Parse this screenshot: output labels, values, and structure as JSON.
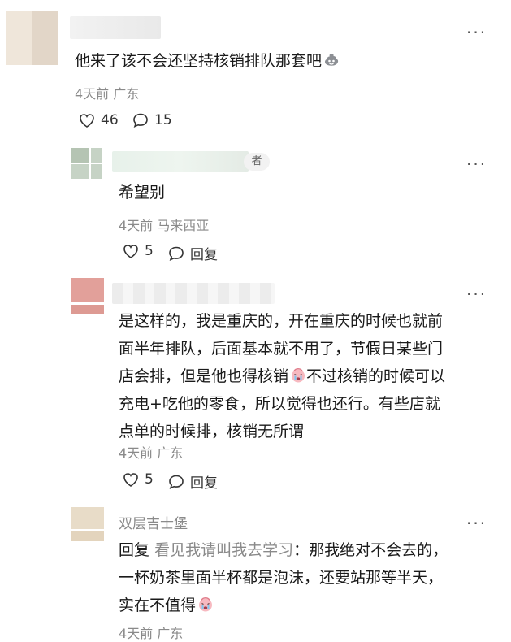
{
  "comments": [
    {
      "body_a": "他来了该不会还坚持核销排队那套吧",
      "emoji": "poop-emoji",
      "time_location": "4天前 广东",
      "likes": "46",
      "replies": "15"
    },
    {
      "author_badge": "者",
      "body": "希望别",
      "time_location": "4天前 马来西亚",
      "likes": "5",
      "reply_label": "回复"
    },
    {
      "body_line1": "是这样的，我是重庆的，开在重庆的时候也就前",
      "body_line2": "面半年排队，后面基本就不用了，节假日某些门",
      "body_line3a": "店会排，但是他也得核销",
      "body_line3b": "不过核销的时候可以",
      "body_line4": "充电+吃他的零食，所以觉得也还行。有些店就",
      "body_line5": "点单的时候排，核销无所谓",
      "emoji": "crying-face-emoji",
      "time_location": "4天前 广东",
      "likes": "5",
      "reply_label": "回复"
    },
    {
      "author": "双层吉士堡",
      "reply_prefix": "回复",
      "reply_target": "看见我请叫我去学习",
      "body_line1": "：那我绝对不会去的，",
      "body_line2": "一杯奶茶里面半杯都是泡沫，还要站那等半天，",
      "body_line3": "实在不值得",
      "emoji": "crying-face-emoji",
      "time_location": "4天前 广东"
    }
  ],
  "more_glyph": "···"
}
